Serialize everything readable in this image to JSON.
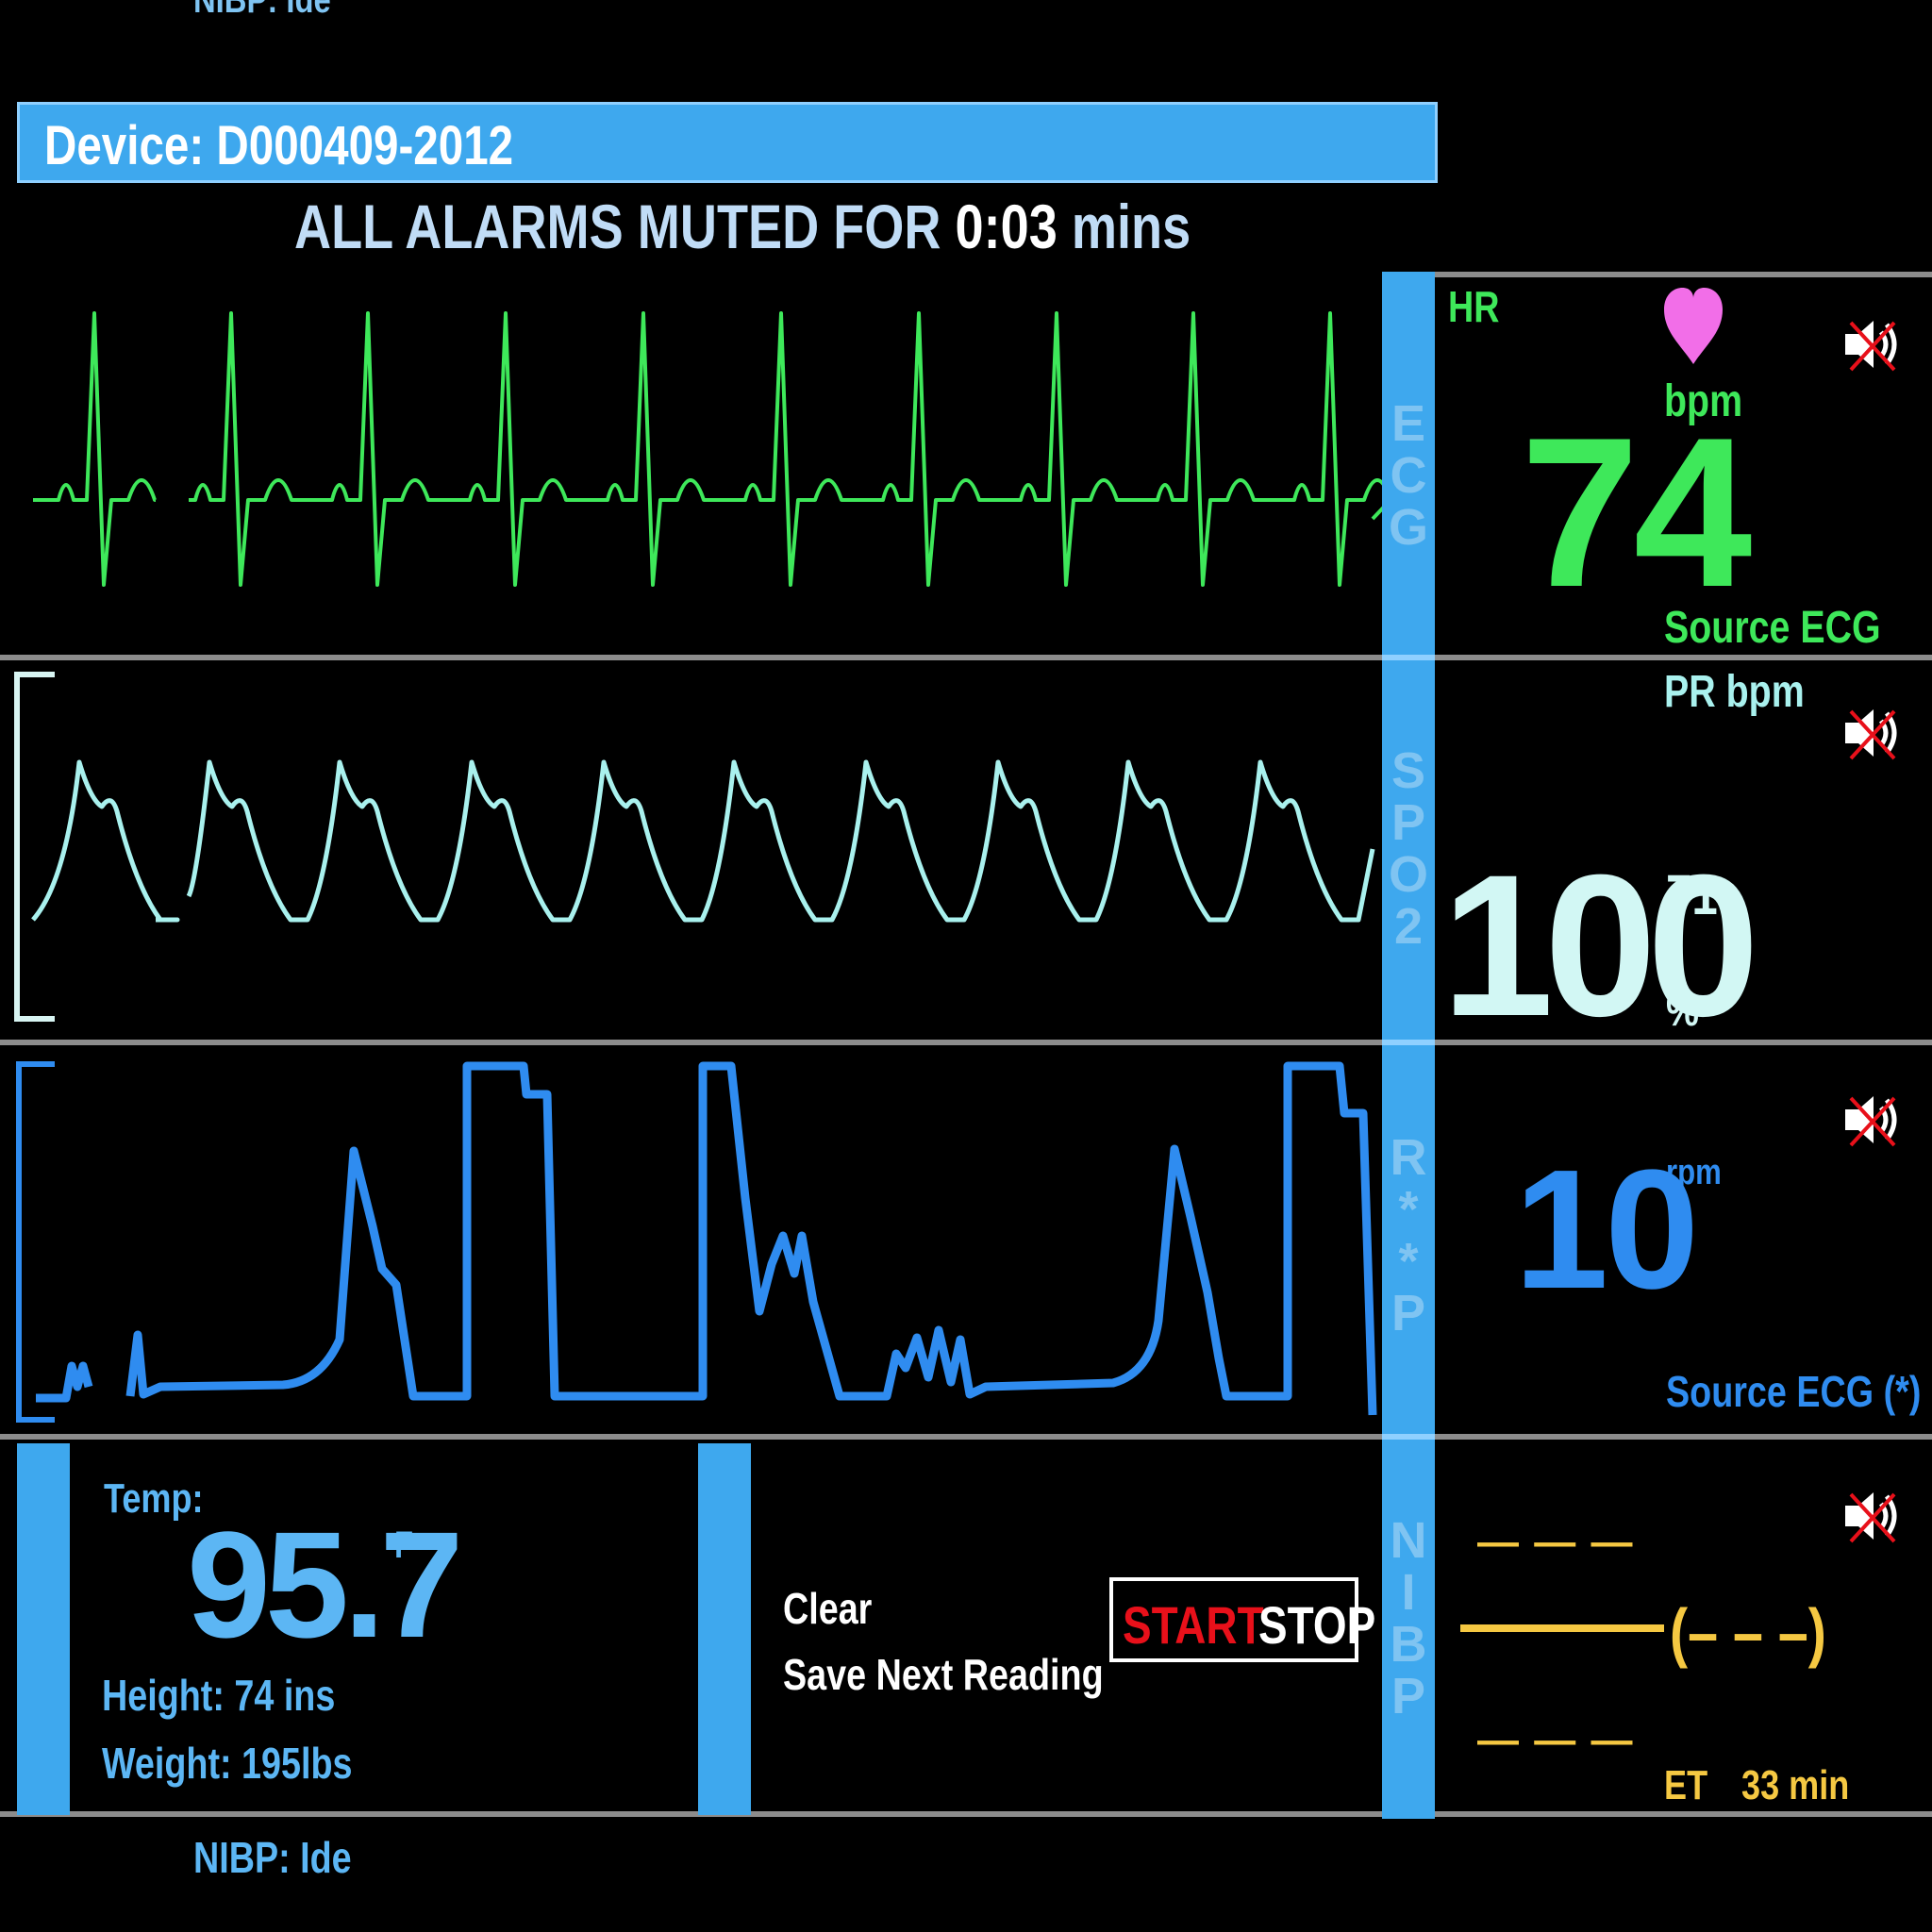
{
  "top_cut_label": "NIBP: Ide",
  "header": {
    "device_label": "Device: D000409-2012",
    "alarm_prefix": "ALL ALARMS MUTED FOR ",
    "alarm_time": "0:03",
    "alarm_suffix": " mins"
  },
  "channels": {
    "ecg": {
      "side_label": [
        "E",
        "C",
        "G"
      ],
      "title": "HR",
      "value": "74",
      "unit": "bpm",
      "source": "Source ECG",
      "heart_icon": "heart-icon",
      "color": "#3ee85a"
    },
    "spo2": {
      "side_label": [
        "S",
        "P",
        "O",
        "2"
      ],
      "title": "PR bpm",
      "value": "100",
      "pr_value": "71",
      "unit": "%",
      "color": "#a9f1ee"
    },
    "resp": {
      "side_label": [
        "R",
        "*",
        "*",
        "P"
      ],
      "value": "10",
      "unit": "rpm",
      "source": "Source ECG (*)",
      "color": "#2f8cf0"
    },
    "nibp": {
      "side_label": [
        "N",
        "I",
        "B",
        "P"
      ],
      "sys": "— — —",
      "mean": "(– – –)",
      "dia": "— — —",
      "et_label": "ET",
      "et_value": "33 min",
      "color": "#f5c842"
    }
  },
  "bottom": {
    "temp_label": "Temp:",
    "temp_value": "95.7",
    "temp_unit": "F",
    "height": "Height: 74 ins",
    "weight": "Weight: 195lbs",
    "clear_label": "Clear",
    "save_label": "Save Next Reading",
    "start_label": "START",
    "stop_label": "STOP",
    "nibp_status": "NIBP: Ide"
  },
  "colors": {
    "accent_blue": "#3ea8ee",
    "divider": "#8c8c8c",
    "start_red": "#e8101a",
    "mute_icon": "speaker-muted-icon"
  }
}
